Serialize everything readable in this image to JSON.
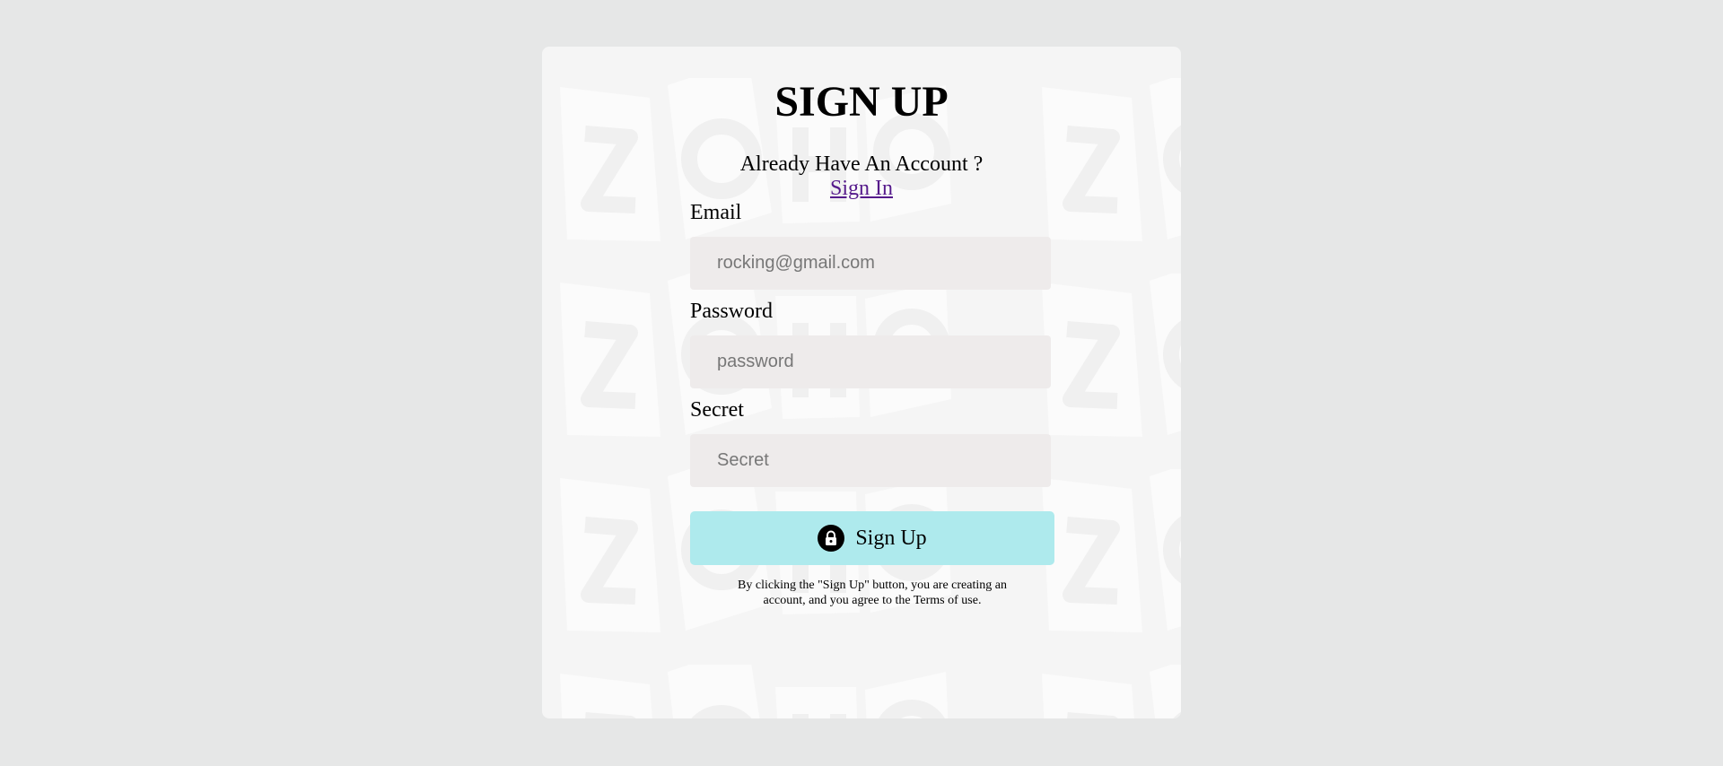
{
  "form": {
    "title": "SIGN UP",
    "already_text": "Already Have An Account ?",
    "signin_link": "Sign In",
    "email": {
      "label": "Email",
      "placeholder": "rocking@gmail.com"
    },
    "password": {
      "label": "Password",
      "placeholder": "password"
    },
    "secret": {
      "label": "Secret",
      "placeholder": "Secret"
    },
    "submit_label": "Sign Up",
    "terms": "By clicking the \"Sign Up\" button, you are creating an account, and you agree to the Terms of use."
  },
  "icons": {
    "submit": "lock-icon",
    "background": "zoho-watermark"
  },
  "colors": {
    "page_bg": "#e6e7e7",
    "card_bg": "#f5f5f5",
    "input_bg": "#eeebeb",
    "button_bg": "#aeeaed",
    "link": "#551a8b"
  }
}
